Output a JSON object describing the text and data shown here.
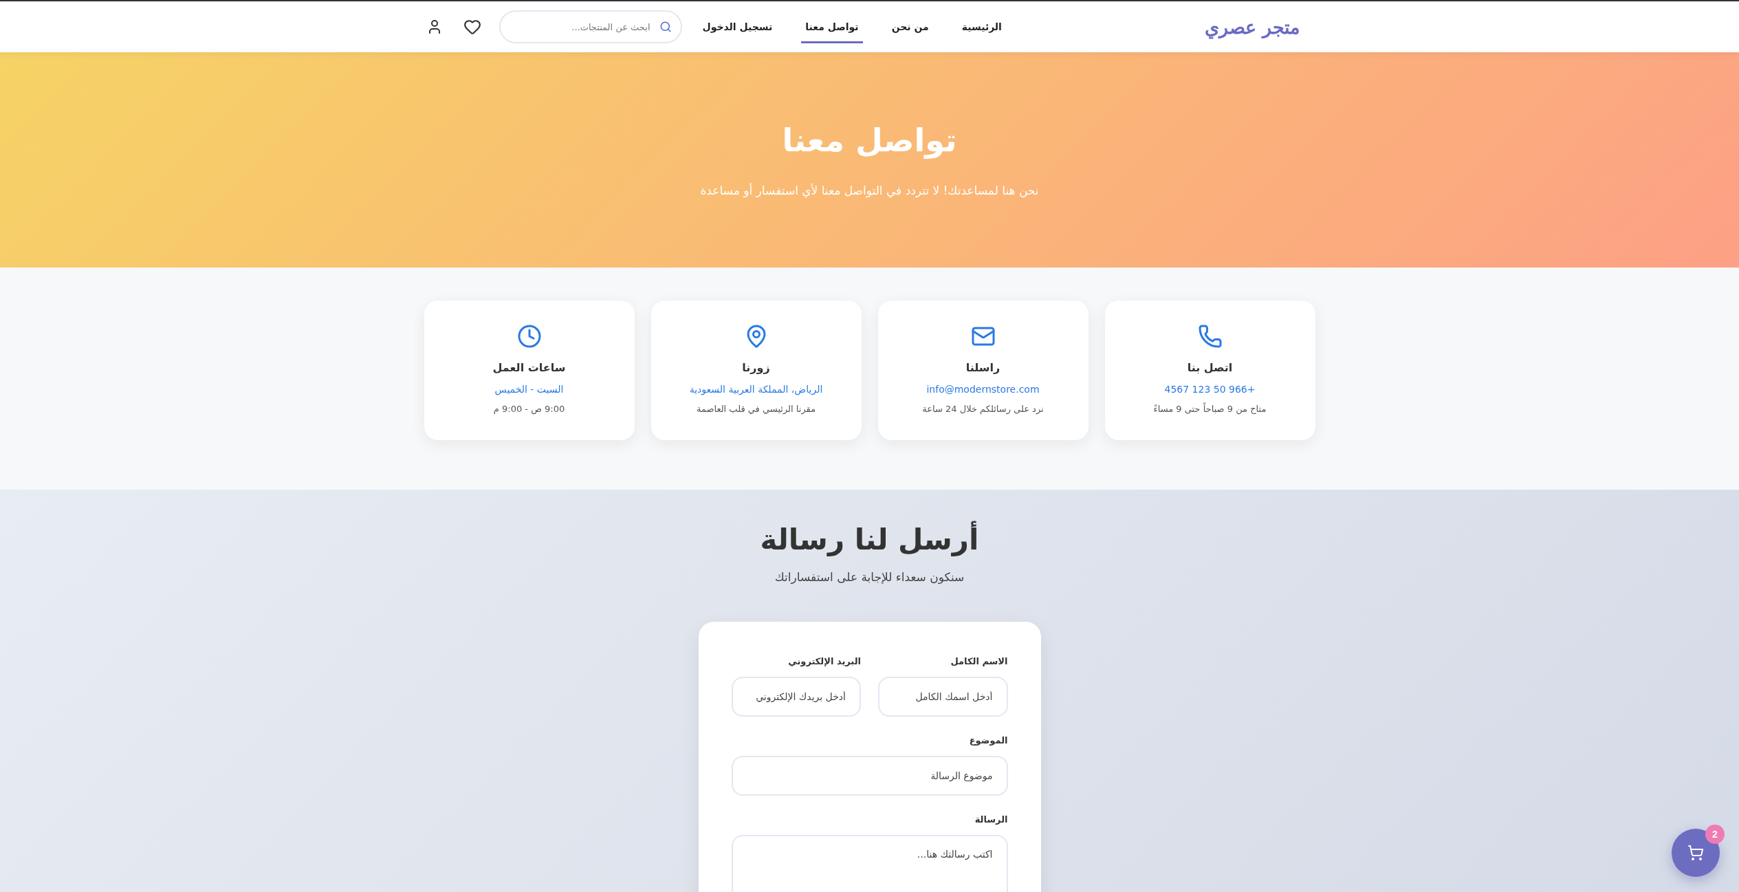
{
  "header": {
    "logo": "متجر عصري",
    "nav": [
      {
        "label": "الرئيسية",
        "selected": false
      },
      {
        "label": "من نحن",
        "selected": false
      },
      {
        "label": "تواصل معنا",
        "selected": true
      },
      {
        "label": "تسجيل الدخول",
        "selected": false
      }
    ],
    "search": {
      "placeholder": "ابحث عن المنتجات..."
    }
  },
  "hero": {
    "title": "تواصل معنا",
    "subtitle": "نحن هنا لمساعدتك! لا تتردد في التواصل معنا لأي استفسار أو مساعدة"
  },
  "contact_cards": [
    {
      "kind": "phone",
      "title": "اتصل بنا",
      "detail": "+966 50 123 4567",
      "note": "متاح من 9 صباحاً حتى 9 مساءً"
    },
    {
      "kind": "email",
      "title": "راسلنا",
      "detail": "info@modernstore.com",
      "note": "نرد على رسائلكم خلال 24 ساعة"
    },
    {
      "kind": "location",
      "title": "زورنا",
      "detail": "الرياض، المملكة العربية السعودية",
      "note": "مقرنا الرئيسي في قلب العاصمة"
    },
    {
      "kind": "hours",
      "title": "ساعات العمل",
      "detail": "السبت - الخميس",
      "note": "9:00 ص - 9:00 م"
    }
  ],
  "contact_form": {
    "title": "أرسل لنا رسالة",
    "subtitle": "سنكون سعداء للإجابة على استفساراتك",
    "rows": [
      [
        {
          "kind": "text",
          "label": "الاسم الكامل",
          "placeholder": "أدخل اسمك الكامل"
        },
        {
          "kind": "email",
          "label": "البريد الإلكتروني",
          "placeholder": "أدخل بريدك الإلكتروني"
        }
      ],
      [
        {
          "kind": "text",
          "label": "الموضوع",
          "placeholder": "موضوع الرسالة"
        }
      ],
      [
        {
          "kind": "textarea",
          "label": "الرسالة",
          "placeholder": "اكتب رسالتك هنا..."
        }
      ]
    ]
  },
  "cart": {
    "count": "2"
  }
}
